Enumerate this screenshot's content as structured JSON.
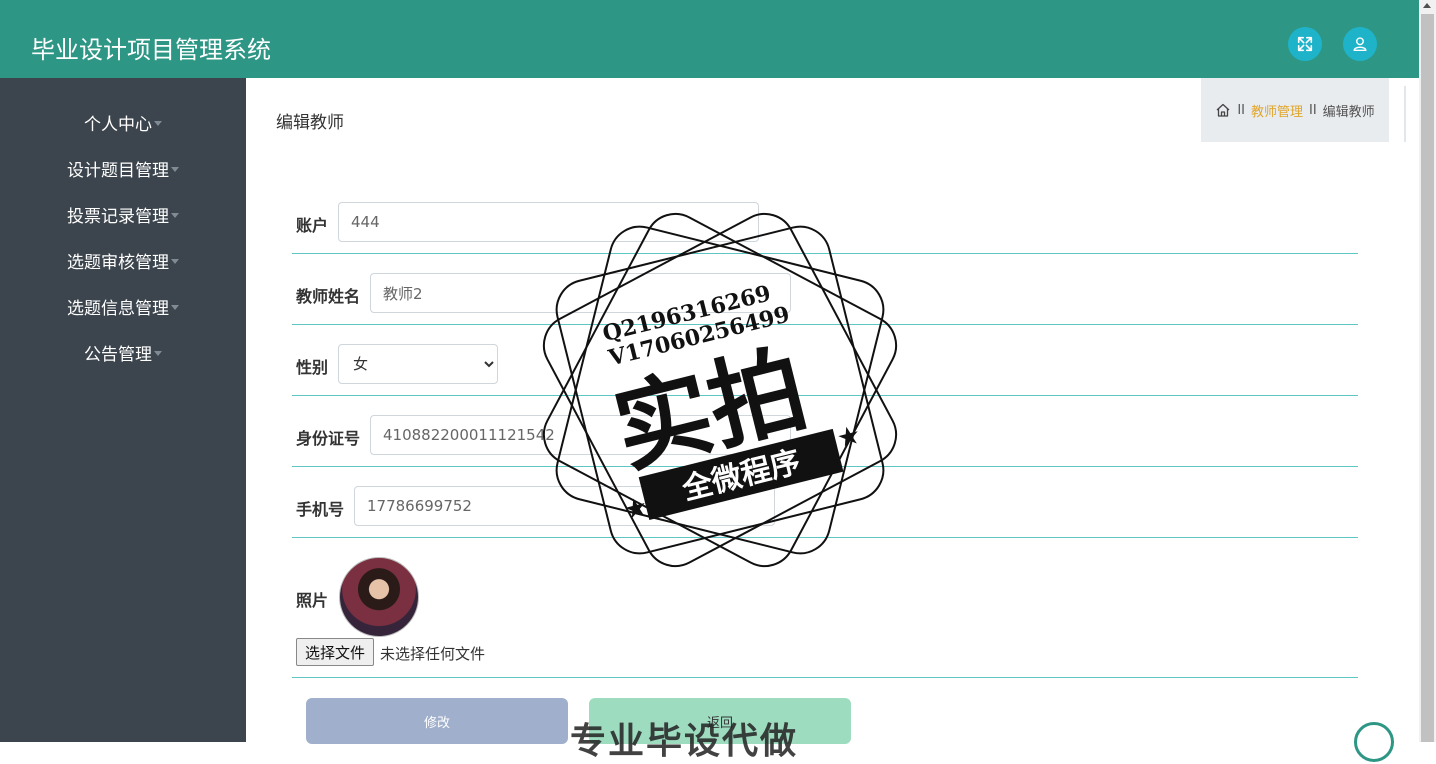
{
  "header": {
    "title": "毕业设计项目管理系统",
    "fullscreen_icon": "expand-icon",
    "user_icon": "user-icon",
    "color": "#2d9685"
  },
  "sidebar": {
    "items": [
      {
        "label": "个人中心"
      },
      {
        "label": "设计题目管理"
      },
      {
        "label": "投票记录管理"
      },
      {
        "label": "选题审核管理"
      },
      {
        "label": "选题信息管理"
      },
      {
        "label": "公告管理"
      }
    ]
  },
  "page": {
    "heading": "编辑教师",
    "breadcrumb": {
      "sep": "II",
      "link": "教师管理",
      "current": "编辑教师"
    }
  },
  "form": {
    "account": {
      "label": "账户",
      "value": "444"
    },
    "name": {
      "label": "教师姓名",
      "value": "教师2"
    },
    "gender": {
      "label": "性别",
      "value": "女"
    },
    "idcard": {
      "label": "身份证号",
      "value": "410882200011121542"
    },
    "phone": {
      "label": "手机号",
      "value": "17786699752"
    },
    "photo": {
      "label": "照片",
      "choose_label": "选择文件",
      "no_file": "未选择任何文件"
    },
    "submit_label": "修改",
    "back_label": "返回"
  },
  "watermark": {
    "contact1": "Q2196316269",
    "contact2": "V17060256499",
    "main": "实拍",
    "ribbon": "全微程序",
    "bottom": "专业毕设代做"
  }
}
